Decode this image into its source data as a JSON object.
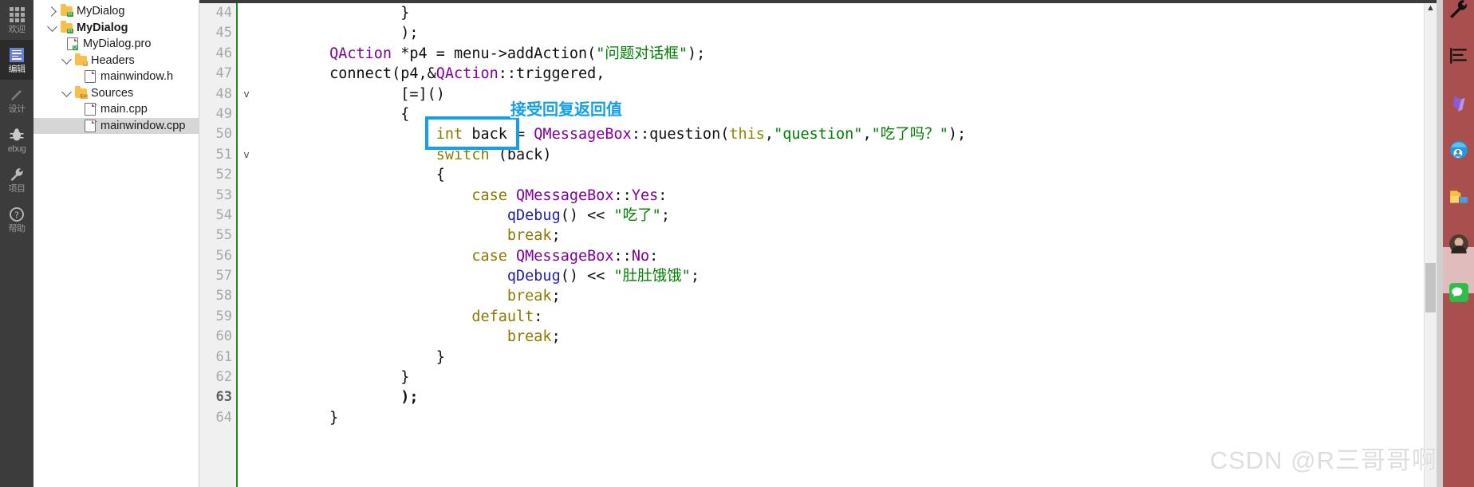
{
  "mode_bar": {
    "items": [
      {
        "label": "欢迎",
        "icon": "grid-icon",
        "active": false
      },
      {
        "label": "编辑",
        "icon": "edit-icon",
        "active": true
      },
      {
        "label": "设计",
        "icon": "design-pencil-icon",
        "active": false
      },
      {
        "label": "ebug",
        "icon": "debug-bug-icon",
        "active": false
      },
      {
        "label": "项目",
        "icon": "project-wrench-icon",
        "active": false
      },
      {
        "label": "帮助",
        "icon": "help-question-icon",
        "active": false
      }
    ]
  },
  "project_tree": {
    "rows": [
      {
        "label": "MyDialog",
        "indent": 0,
        "arrow": "right",
        "icon": "qt-folder-icon",
        "bold": false,
        "selected": false
      },
      {
        "label": "MyDialog",
        "indent": 0,
        "arrow": "down",
        "icon": "qt-folder-icon",
        "bold": true,
        "selected": false
      },
      {
        "label": "MyDialog.pro",
        "indent": 1,
        "arrow": "none",
        "icon": "pro-file-icon",
        "bold": false,
        "selected": false
      },
      {
        "label": "Headers",
        "indent": 1,
        "arrow": "down",
        "icon": "headers-folder-icon",
        "bold": false,
        "selected": false
      },
      {
        "label": "mainwindow.h",
        "indent": 2,
        "arrow": "none",
        "icon": "header-file-icon",
        "bold": false,
        "selected": false
      },
      {
        "label": "Sources",
        "indent": 1,
        "arrow": "down",
        "icon": "sources-folder-icon",
        "bold": false,
        "selected": false
      },
      {
        "label": "main.cpp",
        "indent": 2,
        "arrow": "none",
        "icon": "cpp-file-icon",
        "bold": false,
        "selected": false
      },
      {
        "label": "mainwindow.cpp",
        "indent": 2,
        "arrow": "none",
        "icon": "cpp-file-icon",
        "bold": false,
        "selected": true
      }
    ]
  },
  "editor": {
    "current_line": 63,
    "line_numbers": [
      44,
      45,
      46,
      47,
      48,
      49,
      50,
      51,
      52,
      53,
      54,
      55,
      56,
      57,
      58,
      59,
      60,
      61,
      62,
      63,
      64
    ],
    "fold_markers": {
      "48": "v",
      "51": "v"
    },
    "lines": [
      {
        "n": 44,
        "text": "                }"
      },
      {
        "n": 45,
        "text": "                );"
      },
      {
        "n": 46,
        "text": "        QAction *p4 = menu->addAction(\"问题对话框\");"
      },
      {
        "n": 47,
        "text": "        connect(p4,&QAction::triggered,"
      },
      {
        "n": 48,
        "text": "                [=]()"
      },
      {
        "n": 49,
        "text": "                {"
      },
      {
        "n": 50,
        "text": "                    int back = QMessageBox::question(this,\"question\",\"吃了吗？\");"
      },
      {
        "n": 51,
        "text": "                    switch (back)"
      },
      {
        "n": 52,
        "text": "                    {"
      },
      {
        "n": 53,
        "text": "                        case QMessageBox::Yes:"
      },
      {
        "n": 54,
        "text": "                            qDebug() << \"吃了\";"
      },
      {
        "n": 55,
        "text": "                            break;"
      },
      {
        "n": 56,
        "text": "                        case QMessageBox::No:"
      },
      {
        "n": 57,
        "text": "                            qDebug() << \"肚肚饿饿\";"
      },
      {
        "n": 58,
        "text": "                            break;"
      },
      {
        "n": 59,
        "text": "                        default:"
      },
      {
        "n": 60,
        "text": "                            break;"
      },
      {
        "n": 61,
        "text": "                    }"
      },
      {
        "n": 62,
        "text": "                }"
      },
      {
        "n": 63,
        "text": "                );"
      },
      {
        "n": 64,
        "text": "        }"
      }
    ]
  },
  "annotation": {
    "text": "接受回复返回值",
    "color": "#13a0e8",
    "highlighted_code": "int back"
  },
  "scrollbar": {
    "up_arrow": "▲"
  },
  "taskbar": {
    "icons": [
      "wrench-tool-icon",
      "list-lines-icon",
      "purple-ribbon-icon",
      "blue-globe-person-icon",
      "file-explorer-icon",
      "avatar-photo-icon",
      "wechat-green-icon"
    ]
  },
  "watermark": {
    "text": "CSDN @R三哥哥啊"
  },
  "colors": {
    "accent_blue": "#13a0e8",
    "gutter_bg": "#f0f0f0",
    "gutter_rule_green": "#1f8a24",
    "taskbar_red": "#a9504f",
    "mode_bar_bg": "#3c3c3c",
    "selection_gray": "#d6d6d6",
    "keyword": "#8a7a00",
    "type": "#8000a0",
    "string": "#008000",
    "qdebug": "#2020b0"
  }
}
